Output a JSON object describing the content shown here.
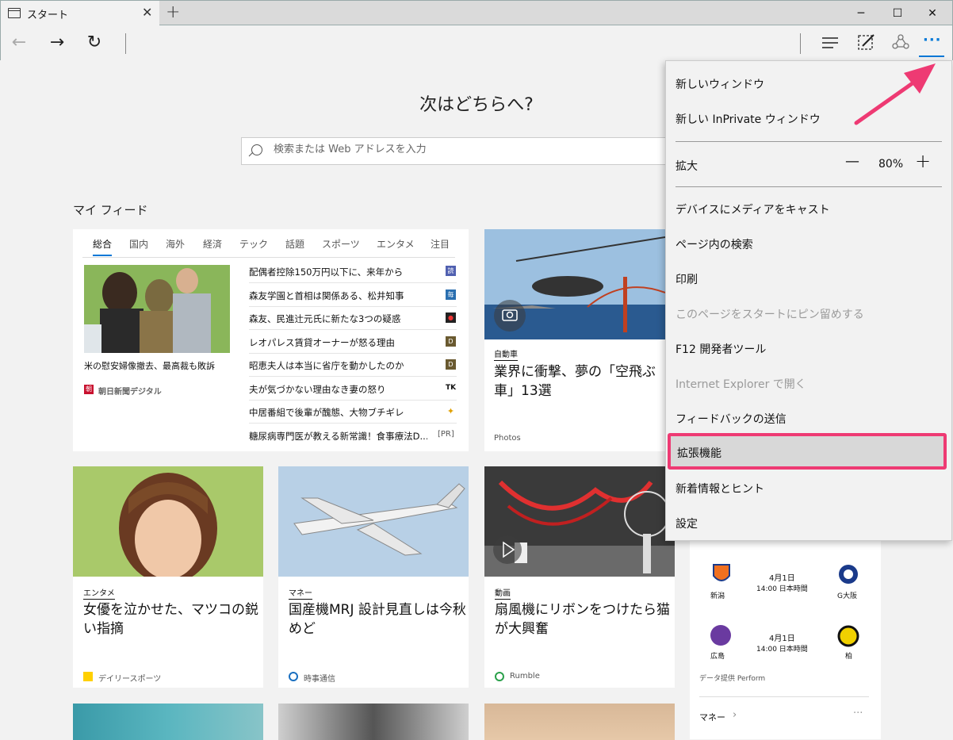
{
  "window": {
    "tab_title": "スタート",
    "new_tab": "+",
    "minimize": "─",
    "maximize": "☐",
    "close": "✕"
  },
  "nav": {
    "back": "←",
    "forward": "→",
    "refresh": "↻",
    "more": "···"
  },
  "start": {
    "heading": "次はどちらへ?",
    "search_placeholder": "検索または Web アドレスを入力",
    "feed_title": "マイ フィード"
  },
  "news_tabs": [
    "総合",
    "国内",
    "海外",
    "経済",
    "テック",
    "話題",
    "スポーツ",
    "エンタメ",
    "注目"
  ],
  "lead_story": {
    "caption": "米の慰安婦像撤去、最高裁も敗訴",
    "source": "朝日新聞デジタル"
  },
  "headlines": [
    {
      "text": "配偶者控除150万円以下に、来年から",
      "badge": "読",
      "color": "#5060b0"
    },
    {
      "text": "森友学園と首相は関係ある、松井知事",
      "badge": "毎",
      "color": "#2a6fb0"
    },
    {
      "text": "森友、民進辻元氏に新たな3つの疑惑",
      "badge": "●",
      "color": "#222"
    },
    {
      "text": "レオパレス賃貸オーナーが怒る理由",
      "badge": "D",
      "color": "#6a5a30"
    },
    {
      "text": "昭恵夫人は本当に省庁を動かしたのか",
      "badge": "D",
      "color": "#6a5a30"
    },
    {
      "text": "夫が気づかない理由なき妻の怒り",
      "badge": "TK",
      "color": "#222"
    },
    {
      "text": "中居番組で後輩が醜態、大物ブチギレ",
      "badge": "✦",
      "color": "#e0a000"
    },
    {
      "text": "糖尿病専門医が教える新常識！食事療法D...",
      "badge": "[PR]",
      "color": ""
    }
  ],
  "feature_card": {
    "category": "自動車",
    "title": "業界に衝撃、夢の「空飛ぶ車」13選",
    "source": "Photos"
  },
  "cards": [
    {
      "category": "エンタメ",
      "title": "女優を泣かせた、マツコの鋭い指摘",
      "source": "デイリースポーツ"
    },
    {
      "category": "マネー",
      "title": "国産機MRJ 設計見直しは今秋めど",
      "source": "時事通信"
    },
    {
      "category": "動画",
      "title": "扇風機にリボンをつけたら猫が大興奮",
      "source": "Rumble"
    }
  ],
  "sports": {
    "matches": [
      {
        "home": "新潟",
        "away": "G大阪",
        "date": "4月1日",
        "time": "14:00 日本時間"
      },
      {
        "home": "広島",
        "away": "柏",
        "date": "4月1日",
        "time": "14:00 日本時間"
      }
    ],
    "provider": "データ提供 Perform",
    "next_section": "マネー",
    "next_chevron": "›",
    "more": "···"
  },
  "menu": {
    "new_window": "新しいウィンドウ",
    "new_inprivate": "新しい InPrivate ウィンドウ",
    "zoom_label": "拡大",
    "zoom_minus": "—",
    "zoom_value": "80%",
    "zoom_plus": "+",
    "cast": "デバイスにメディアをキャスト",
    "find": "ページ内の検索",
    "print": "印刷",
    "pin": "このページをスタートにピン留めする",
    "devtools": "F12 開発者ツール",
    "open_ie": "Internet Explorer で開く",
    "feedback": "フィードバックの送信",
    "extensions": "拡張機能",
    "whats_new": "新着情報とヒント",
    "settings": "設定"
  },
  "colors": {
    "accent": "#0078d7",
    "highlight": "#ee3a73"
  }
}
